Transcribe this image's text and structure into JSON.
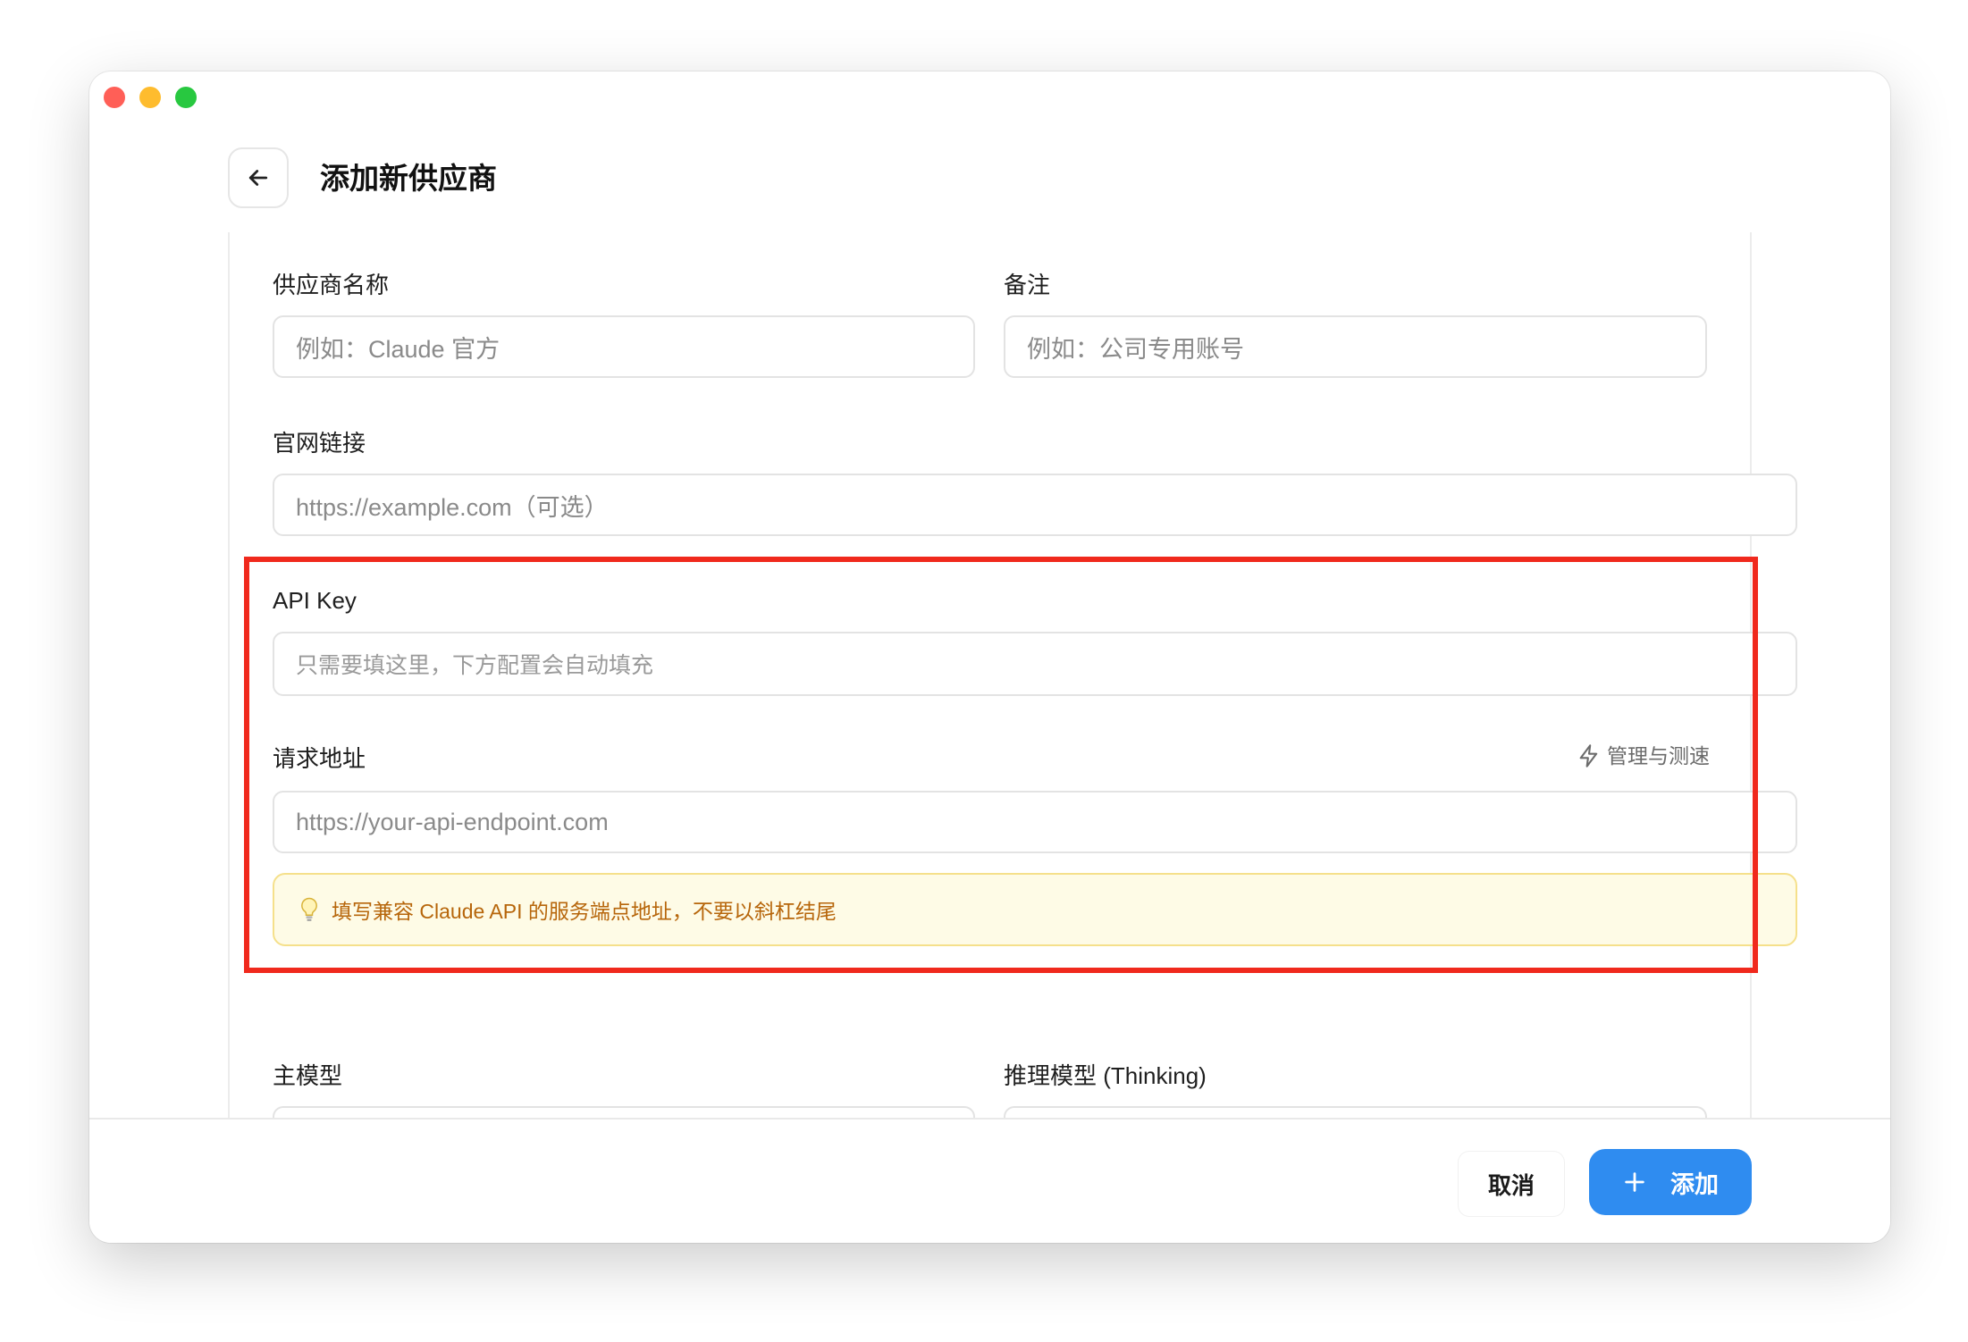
{
  "header": {
    "title": "添加新供应商"
  },
  "form": {
    "provider_name": {
      "label": "供应商名称",
      "placeholder": "例如：Claude 官方"
    },
    "notes": {
      "label": "备注",
      "placeholder": "例如：公司专用账号"
    },
    "website": {
      "label": "官网链接",
      "placeholder": "https://example.com（可选）"
    },
    "api_key": {
      "label": "API Key",
      "placeholder": "只需要填这里，下方配置会自动填充"
    },
    "endpoint": {
      "label": "请求地址",
      "placeholder": "https://your-api-endpoint.com",
      "manage_label": "管理与测速",
      "hint": "填写兼容 Claude API 的服务端点地址，不要以斜杠结尾"
    },
    "main_model": {
      "label": "主模型",
      "value": ""
    },
    "reasoning_model": {
      "label": "推理模型 (Thinking)",
      "value": ""
    }
  },
  "footer": {
    "cancel_label": "取消",
    "add_label": "添加"
  },
  "icons": {
    "back": "arrow-left-icon",
    "bolt": "lightning-icon",
    "bulb": "lightbulb-icon",
    "plus": "plus-icon"
  },
  "colors": {
    "accent": "#2f8cf0",
    "highlight": "#f0291d",
    "hint_bg": "#fefbe6",
    "hint_text": "#b7660b"
  }
}
